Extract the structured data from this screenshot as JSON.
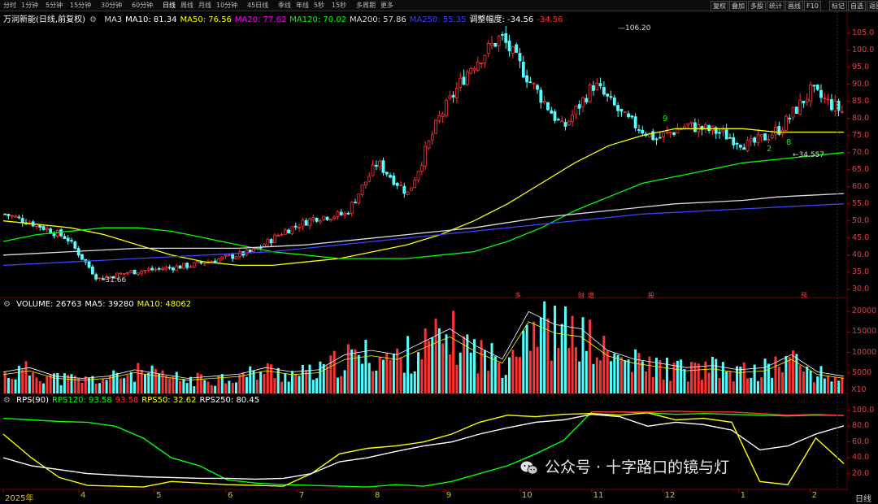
{
  "toolbar": {
    "periods": [
      "分时",
      "1分钟",
      "5分钟",
      "15分钟",
      "30分钟",
      "60分钟",
      "日线",
      "周线",
      "月线",
      "10分钟",
      "45日线",
      "季线",
      "年线",
      "5秒",
      "15秒",
      "多周期",
      "更多"
    ],
    "active": "日线",
    "right_buttons": [
      "复权",
      "叠加",
      "多股",
      "统计",
      "画线",
      "F10",
      "标记",
      "自选",
      "返回"
    ]
  },
  "main_legend": {
    "name": "万润新能(日线,前复权)",
    "items": [
      {
        "text": "MA3",
        "color": "#dcdcdc"
      },
      {
        "text": "MA10: 81.34",
        "color": "#ffffff"
      },
      {
        "text": "MA50: 76.56",
        "color": "#ffff00"
      },
      {
        "text": "MA20: 77.62",
        "color": "#ff00ff"
      },
      {
        "text": "MA120: 70.02",
        "color": "#00ff00"
      },
      {
        "text": "MA200: 57.86",
        "color": "#dcdcdc"
      },
      {
        "text": "MA250: 55.35",
        "color": "#4040ff"
      },
      {
        "text": "调整幅度: -34.56",
        "color": "#ffffff"
      },
      {
        "text": "-34.56",
        "color": "#ff3030"
      }
    ]
  },
  "volume_legend": [
    {
      "text": "VOLUME: 26763",
      "color": "#ffffff"
    },
    {
      "text": "MA5: 39280",
      "color": "#ffffff"
    },
    {
      "text": "MA10: 48062",
      "color": "#ffff00"
    }
  ],
  "rps_legend": [
    {
      "text": "RPS(90)",
      "color": "#ffffff"
    },
    {
      "text": "RPS120: 93.58",
      "color": "#00ff00"
    },
    {
      "text": "93.58",
      "color": "#ff3030"
    },
    {
      "text": "RPS50: 32.62",
      "color": "#ffff00"
    },
    {
      "text": "RPS250: 80.45",
      "color": "#ffffff"
    }
  ],
  "price_axis_ticks": [
    "105.0",
    "100.0",
    "95.0",
    "90.0",
    "85.0",
    "80.0",
    "75.0",
    "70.0",
    "65.0",
    "60.0",
    "55.0",
    "50.0",
    "45.0",
    "40.0",
    "35.0",
    "30.0"
  ],
  "volume_axis_ticks": [
    "20000",
    "15000",
    "10000",
    "5000"
  ],
  "volume_unit": "X10",
  "rps_axis_ticks": [
    "100.0",
    "80.0",
    "60.0",
    "40.0",
    "20.0"
  ],
  "x_axis_labels": [
    "2025年",
    "4",
    "5",
    "6",
    "7",
    "8",
    "9",
    "10",
    "11",
    "12",
    "1",
    "2"
  ],
  "x_axis_right": "日线",
  "annotations": {
    "high": "106.20",
    "low": "31.66",
    "recent_low": "34.557",
    "marks": [
      "9",
      "2",
      "8"
    ],
    "events": [
      "多",
      "财",
      "增",
      "股",
      "预"
    ]
  },
  "watermark": "公众号 · 十字路口的镜与灯",
  "chart_data": [
    {
      "type": "candlestick",
      "title": "万润新能(日线,前复权)",
      "ylim": [
        29,
        108
      ],
      "x_labels": [
        "2025年",
        "4",
        "5",
        "6",
        "7",
        "8",
        "9",
        "10",
        "11",
        "12",
        "1",
        "2"
      ],
      "ohlc_anchors": [
        {
          "m": "2025-03",
          "close": 52
        },
        {
          "m": "2025-03-mid",
          "close": 49
        },
        {
          "m": "2025-04-start",
          "close": 45
        },
        {
          "m": "2025-04-low",
          "close": 33
        },
        {
          "m": "2025-04-end",
          "close": 35
        },
        {
          "m": "2025-05",
          "close": 36
        },
        {
          "m": "2025-06",
          "close": 37
        },
        {
          "m": "2025-07",
          "close": 39
        },
        {
          "m": "2025-08-start",
          "close": 41
        },
        {
          "m": "2025-08-end",
          "close": 47
        },
        {
          "m": "2025-09",
          "close": 51
        },
        {
          "m": "2025-09-end",
          "close": 52
        },
        {
          "m": "2025-10-start",
          "close": 67
        },
        {
          "m": "2025-10-mid",
          "close": 58
        },
        {
          "m": "2025-10-end",
          "close": 80
        },
        {
          "m": "2025-11-start",
          "close": 95
        },
        {
          "m": "2025-11-high",
          "close": 104
        },
        {
          "m": "2025-11-mid",
          "close": 90
        },
        {
          "m": "2025-11-end",
          "close": 77
        },
        {
          "m": "2025-12-start",
          "close": 90
        },
        {
          "m": "2025-12",
          "close": 80
        },
        {
          "m": "2025-12-end",
          "close": 74
        },
        {
          "m": "2026-01",
          "close": 78
        },
        {
          "m": "2026-01-mid",
          "close": 76
        },
        {
          "m": "2026-01-end",
          "close": 72
        },
        {
          "m": "2026-02",
          "close": 77
        },
        {
          "m": "2026-02-high",
          "close": 88
        },
        {
          "m": "2026-02-end",
          "close": 82
        }
      ],
      "series": [
        {
          "name": "MA50",
          "color": "#ffff00",
          "values": [
            50,
            49,
            48,
            46,
            43,
            40,
            38,
            37,
            37,
            38,
            39,
            41,
            43,
            46,
            50,
            55,
            61,
            67,
            72,
            75,
            77,
            77,
            77,
            76,
            76,
            76
          ]
        },
        {
          "name": "MA120",
          "color": "#00ff00",
          "values": [
            44,
            46,
            47,
            48,
            48,
            47,
            45,
            43,
            41,
            40,
            39,
            39,
            39,
            40,
            41,
            44,
            48,
            53,
            57,
            61,
            63,
            65,
            67,
            68,
            69,
            70
          ]
        },
        {
          "name": "MA200",
          "color": "#dcdcdc",
          "values": [
            40,
            40.5,
            41,
            41.5,
            42,
            42,
            42,
            42,
            42.5,
            43,
            44,
            45,
            46,
            47,
            48,
            49.5,
            51,
            52,
            53,
            54,
            55,
            55.5,
            56,
            57,
            57.5,
            58
          ]
        },
        {
          "name": "MA250",
          "color": "#4040ff",
          "values": [
            37,
            37.5,
            38,
            38.5,
            39,
            39.5,
            40,
            40.5,
            41,
            42,
            43,
            44,
            45,
            46,
            47,
            48,
            49,
            50,
            51,
            52,
            52.5,
            53,
            53.5,
            54,
            54.5,
            55
          ]
        }
      ]
    },
    {
      "type": "bar",
      "title": "VOLUME",
      "ylim": [
        0,
        21000
      ],
      "unit": "X10",
      "values_anchor": [
        5000,
        6000,
        4000,
        3500,
        4000,
        5500,
        4500,
        3500,
        4000,
        4500,
        6000,
        5000,
        5500,
        9000,
        10000,
        9000,
        12000,
        15000,
        11000,
        8000,
        19000,
        16000,
        15000,
        10000,
        8000,
        7000,
        6000,
        6500,
        5500,
        6000,
        9000,
        5000,
        4000
      ]
    },
    {
      "type": "line",
      "title": "RPS(90)",
      "ylim": [
        0,
        105
      ],
      "series": [
        {
          "name": "RPS120",
          "color": "#00ff00",
          "values": [
            90,
            88,
            86,
            85,
            80,
            65,
            40,
            30,
            12,
            8,
            6,
            5,
            4,
            3,
            6,
            4,
            10,
            20,
            30,
            45,
            62,
            98,
            98,
            97,
            95,
            96,
            95,
            94,
            93,
            94,
            93.58
          ]
        },
        {
          "name": "RPS50",
          "color": "#ffff00",
          "values": [
            70,
            40,
            15,
            5,
            4,
            3,
            10,
            8,
            6,
            5,
            4,
            20,
            45,
            52,
            55,
            60,
            70,
            85,
            94,
            92,
            95,
            96,
            94,
            97,
            88,
            90,
            85,
            10,
            6,
            65,
            32.62
          ]
        },
        {
          "name": "RPS250",
          "color": "#ffffff",
          "values": [
            40,
            30,
            25,
            20,
            18,
            16,
            15,
            14,
            14,
            13,
            14,
            20,
            35,
            40,
            48,
            55,
            60,
            70,
            78,
            85,
            88,
            95,
            92,
            80,
            85,
            82,
            75,
            50,
            55,
            70,
            80.45
          ]
        },
        {
          "name": "RPS(90)",
          "color": "#ff3030",
          "values": [
            null,
            null,
            null,
            null,
            null,
            null,
            null,
            null,
            null,
            null,
            null,
            null,
            null,
            null,
            null,
            null,
            null,
            null,
            null,
            null,
            null,
            98,
            98,
            98,
            99,
            98,
            98,
            96,
            94,
            95,
            93.58
          ]
        }
      ]
    }
  ]
}
